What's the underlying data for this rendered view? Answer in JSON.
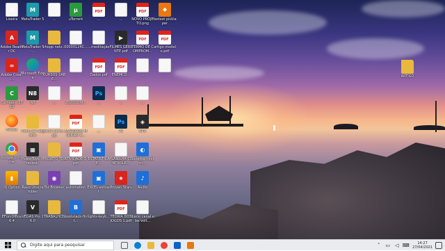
{
  "desktop": {
    "icons": [
      {
        "label": "Lixeira",
        "glyph": "recycle-bin-icon",
        "style": "g-doc",
        "ch": "♻"
      },
      {
        "label": "Adobe Reader DC",
        "glyph": "acrobat-icon",
        "style": "g-red",
        "ch": "A"
      },
      {
        "label": "Adobe Creati...",
        "glyph": "creative-cloud-icon",
        "style": "g-red",
        "ch": "∞"
      },
      {
        "label": "Camtasia 2019",
        "glyph": "camtasia-icon",
        "style": "g-green",
        "ch": "C"
      },
      {
        "label": "Firefox",
        "glyph": "firefox-icon",
        "style": "g-firefox",
        "ch": ""
      },
      {
        "label": "Google Chrome",
        "glyph": "chrome-icon",
        "style": "g-chrome",
        "ch": ""
      },
      {
        "label": "IQ Option",
        "glyph": "iq-option-icon",
        "style": "g-gold",
        "ch": "▮"
      },
      {
        "label": "EForcOffice 6.4",
        "glyph": "document-icon",
        "style": "g-doc",
        "ch": ""
      },
      {
        "label": "MetaTrader 5",
        "glyph": "metatrader-icon",
        "style": "g-teal",
        "ch": "M"
      },
      {
        "label": "MetaTrader 5 - ...",
        "glyph": "metatrader-icon",
        "style": "g-teal",
        "ch": "M"
      },
      {
        "label": "Microsoft Edge",
        "glyph": "edge-icon",
        "style": "g-edge",
        "ch": ""
      },
      {
        "label": "N8",
        "glyph": "n8-icon",
        "style": "g-dark",
        "ch": "N8"
      },
      {
        "label": "Plano de Negócio",
        "glyph": "folder-icon",
        "style": "g-folder",
        "ch": ""
      },
      {
        "label": "PowerToys (Preview)",
        "glyph": "powertoys-icon",
        "style": "g-dark",
        "ch": "▦"
      },
      {
        "label": "Ravo Unscrambler",
        "glyph": "folder-icon",
        "style": "g-folder",
        "ch": ""
      },
      {
        "label": "VEGAS Pro 16.0",
        "glyph": "vegas-icon",
        "style": "g-dark",
        "ch": "V"
      },
      {
        "label": "...",
        "glyph": "document-icon",
        "style": "g-doc",
        "ch": ""
      },
      {
        "label": "chopp netz...",
        "glyph": "folder-icon",
        "style": "g-folder",
        "ch": ""
      },
      {
        "label": "CURSOS SABE...",
        "glyph": "folder-icon",
        "style": "g-folder",
        "ch": ""
      },
      {
        "label": "...",
        "glyph": "document-icon",
        "style": "g-doc",
        "ch": ""
      },
      {
        "label": "excel samu..pg",
        "glyph": "document-icon",
        "style": "g-doc",
        "ch": ""
      },
      {
        "label": "PROJETO TCC",
        "glyph": "folder-icon",
        "style": "g-folder",
        "ch": ""
      },
      {
        "label": "Tor Browser",
        "glyph": "tor-icon",
        "style": "g-purple",
        "ch": "◉"
      },
      {
        "label": "TRABALHOS",
        "glyph": "folder-icon",
        "style": "g-folder",
        "ch": ""
      },
      {
        "label": "uTorrent",
        "glyph": "utorrent-icon",
        "style": "g-green",
        "ch": "μ"
      },
      {
        "label": "00000124C...",
        "glyph": "document-icon",
        "style": "g-doc",
        "ch": ""
      },
      {
        "label": "...",
        "glyph": "document-icon",
        "style": "g-doc",
        "ch": ""
      },
      {
        "label": "20200209...",
        "glyph": "document-icon",
        "style": "g-doc",
        "ch": ""
      },
      {
        "label": "ATIVIDADE MÓDULO 2...",
        "glyph": "pdf-icon",
        "style": "g-pdf",
        "ch": "PDF"
      },
      {
        "label": "ATIVIDADE 3.pdf",
        "glyph": "pdf-icon",
        "style": "g-pdf",
        "ch": "PDF"
      },
      {
        "label": "automation",
        "glyph": "document-icon",
        "style": "g-doc",
        "ch": ""
      },
      {
        "label": "bootstack-fint...",
        "glyph": "app-icon",
        "style": "g-blue",
        "ch": "B"
      },
      {
        "label": "...",
        "glyph": "pdf-icon",
        "style": "g-pdf",
        "ch": "PDF"
      },
      {
        "label": "...meditação",
        "glyph": "document-icon",
        "style": "g-doc",
        "ch": ""
      },
      {
        "label": "Dados.pdf",
        "glyph": "pdf-icon",
        "style": "g-pdf",
        "ch": "PDF"
      },
      {
        "label": "...",
        "glyph": "photoshop-icon",
        "style": "g-ps",
        "ch": "Ps"
      },
      {
        "label": "...",
        "glyph": "document-icon",
        "style": "g-doc",
        "ch": ""
      },
      {
        "label": "ESTATÍSTICA E...",
        "glyph": "app-icon",
        "style": "g-blue",
        "ch": "▣"
      },
      {
        "label": "EXCEL-extract",
        "glyph": "app-icon",
        "style": "g-blue",
        "ch": "▣"
      },
      {
        "label": "lights-keyb...",
        "glyph": "document-icon",
        "style": "g-doc",
        "ch": ""
      },
      {
        "label": "...",
        "glyph": "document-icon",
        "style": "g-doc",
        "ch": ""
      },
      {
        "label": "FILMES GERENTE.pdf",
        "glyph": "movie-icon",
        "style": "g-dark",
        "ch": "▶"
      },
      {
        "label": "ENEMCO...",
        "glyph": "pdf-icon",
        "style": "g-pdf",
        "ch": "PDF"
      },
      {
        "label": "...",
        "glyph": "document-icon",
        "style": "g-doc",
        "ch": ""
      },
      {
        "label": "Ps",
        "glyph": "photoshop-icon",
        "style": "g-ps",
        "ch": "Ps"
      },
      {
        "label": "PLANILHA CONTROLE...",
        "glyph": "document-icon",
        "style": "g-doc",
        "ch": ""
      },
      {
        "label": "Proven Stars",
        "glyph": "star-icon",
        "style": "g-red",
        "ch": "★"
      },
      {
        "label": "TEORIA DOS JOGOS 1.pdf",
        "glyph": "pdf-icon",
        "style": "g-pdf",
        "ch": "PDF"
      },
      {
        "label": "NOVO PROJETO.png",
        "glyph": "pdf-icon",
        "style": "g-pdf",
        "ch": "PDF"
      },
      {
        "label": "TERMO DE COMPROM...",
        "glyph": "pdf-icon",
        "style": "g-pdf",
        "ch": "PDF"
      },
      {
        "label": "...",
        "glyph": "document-icon",
        "style": "g-doc",
        "ch": ""
      },
      {
        "label": "...",
        "glyph": "document-icon",
        "style": "g-doc",
        "ch": ""
      },
      {
        "label": "VPN",
        "glyph": "vpn-icon",
        "style": "g-dark",
        "ch": "◈"
      },
      {
        "label": "Sistema Inform...",
        "glyph": "app-icon",
        "style": "g-blue",
        "ch": "◐"
      },
      {
        "label": "Audio",
        "glyph": "audio-icon",
        "style": "g-blue",
        "ch": "♪"
      },
      {
        "label": "diário canal elas volt...",
        "glyph": "document-icon",
        "style": "g-doc",
        "ch": ""
      },
      {
        "label": "fastest picklaper",
        "glyph": "app-icon",
        "style": "g-orange",
        "ch": "⬥"
      },
      {
        "label": "artigo modelo.pdf",
        "glyph": "pdf-icon",
        "style": "g-pdf",
        "ch": "PDF"
      },
      {
        "label": "...",
        "glyph": "document-icon",
        "style": "g-doc",
        "ch": ""
      },
      {
        "label": "ARTIGO",
        "glyph": "folder-icon",
        "style": "g-folder",
        "ch": ""
      }
    ]
  },
  "taskbar": {
    "search_placeholder": "Digite aqui para pesquisar",
    "pinned": [
      {
        "name": "task-view-icon",
        "color": "#5a5a5a"
      },
      {
        "name": "edge-taskbar-icon",
        "color": "#0c7fd6"
      },
      {
        "name": "file-explorer-icon",
        "color": "#e9b93e"
      },
      {
        "name": "chrome-taskbar-icon",
        "color": "#ea4335"
      },
      {
        "name": "mail-icon",
        "color": "#0a64c8"
      },
      {
        "name": "app-taskbar-icon",
        "color": "#e8780f"
      }
    ],
    "time": "14:27",
    "date": "27/04/2021"
  }
}
